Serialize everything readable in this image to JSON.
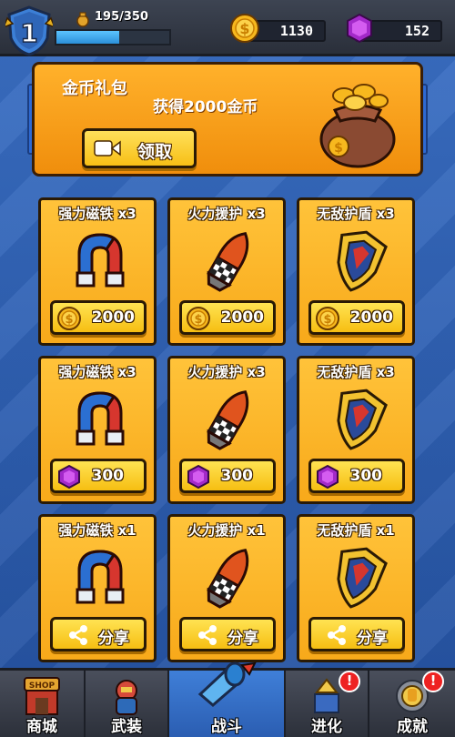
{
  "player": {
    "level": "1",
    "xp_text": "195/350",
    "xp_progress": 0.557,
    "coins": "1130",
    "gems": "152"
  },
  "banner": {
    "title": "金币礼包",
    "subtitle": "获得2000金币",
    "claim_label": "领取"
  },
  "cards": [
    {
      "title": "强力磁铁",
      "qty": "x3",
      "item": "magnet-icon",
      "currency": "coin-icon",
      "price": "2000"
    },
    {
      "title": "火力援护",
      "qty": "x3",
      "item": "rocket-icon",
      "currency": "coin-icon",
      "price": "2000"
    },
    {
      "title": "无敌护盾",
      "qty": "x3",
      "item": "shield-icon",
      "currency": "coin-icon",
      "price": "2000"
    },
    {
      "title": "强力磁铁",
      "qty": "x3",
      "item": "magnet-icon",
      "currency": "gem-icon",
      "price": "300"
    },
    {
      "title": "火力援护",
      "qty": "x3",
      "item": "rocket-icon",
      "currency": "gem-icon",
      "price": "300"
    },
    {
      "title": "无敌护盾",
      "qty": "x3",
      "item": "shield-icon",
      "currency": "gem-icon",
      "price": "300"
    },
    {
      "title": "强力磁铁",
      "qty": "x1",
      "item": "magnet-icon",
      "currency": "share-icon",
      "price": "分享"
    },
    {
      "title": "火力援护",
      "qty": "x1",
      "item": "rocket-icon",
      "currency": "share-icon",
      "price": "分享"
    },
    {
      "title": "无敌护盾",
      "qty": "x1",
      "item": "shield-icon",
      "currency": "share-icon",
      "price": "分享"
    }
  ],
  "nav": {
    "items": [
      {
        "label": "商城",
        "icon": "shop-icon",
        "shop_text": "SHOP"
      },
      {
        "label": "武装",
        "icon": "armor-icon"
      },
      {
        "label": "战斗",
        "icon": "battle-icon"
      },
      {
        "label": "进化",
        "icon": "evolve-icon",
        "alert": "!"
      },
      {
        "label": "成就",
        "icon": "achievement-icon",
        "alert": "!"
      }
    ]
  },
  "colors": {
    "background": "#2b5aa8",
    "card": "#ffc33a",
    "banner": "#f7a11a",
    "button": "#f6be12",
    "nav_active": "#3f7fd8",
    "alert": "#ee2222"
  }
}
